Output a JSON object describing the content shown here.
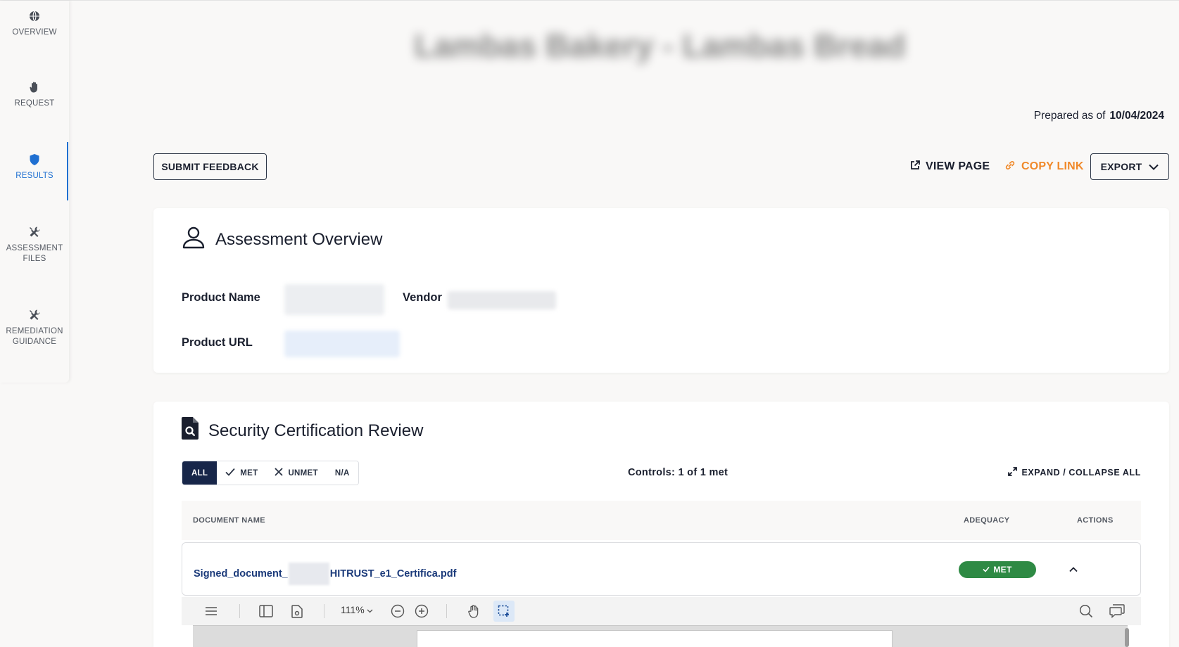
{
  "sidebar": {
    "items": [
      {
        "label": "OVERVIEW",
        "icon": "globe-icon"
      },
      {
        "label": "REQUEST",
        "icon": "hand-icon"
      },
      {
        "label": "RESULTS",
        "icon": "shield-icon",
        "active": true
      },
      {
        "label": "ASSESSMENT FILES",
        "icon": "tools-icon"
      },
      {
        "label": "REMEDIATION GUIDANCE",
        "icon": "tools-icon"
      }
    ]
  },
  "header": {
    "title_blurred": "Lambas Bakery - Lambas Bread",
    "prepared_label": "Prepared as of",
    "prepared_date": "10/04/2024"
  },
  "toolbar": {
    "submit_feedback": "SUBMIT FEEDBACK",
    "view_page": "VIEW PAGE",
    "copy_link": "COPY LINK",
    "export": "EXPORT"
  },
  "overview": {
    "title": "Assessment Overview",
    "product_name_label": "Product Name",
    "vendor_label": "Vendor",
    "product_url_label": "Product URL"
  },
  "cert_review": {
    "title": "Security Certification Review",
    "filters": [
      "ALL",
      "MET",
      "UNMET",
      "N/A"
    ],
    "controls_text": "Controls: 1 of 1 met",
    "expand_collapse": "EXPAND / COLLAPSE ALL",
    "columns": {
      "document": "DOCUMENT NAME",
      "adequacy": "ADEQUACY",
      "actions": "ACTIONS"
    },
    "rows": [
      {
        "doc_prefix": "Signed_document_",
        "doc_suffix": "HITRUST_e1_Certifica.pdf",
        "adequacy": "MET"
      }
    ]
  },
  "pdf_viewer": {
    "zoom": "111%"
  },
  "colors": {
    "accent_blue": "#1f6fd1",
    "navy": "#172649",
    "link_orange": "#f0892a",
    "met_green": "#2e8a44",
    "doc_link": "#1b3a7a"
  }
}
